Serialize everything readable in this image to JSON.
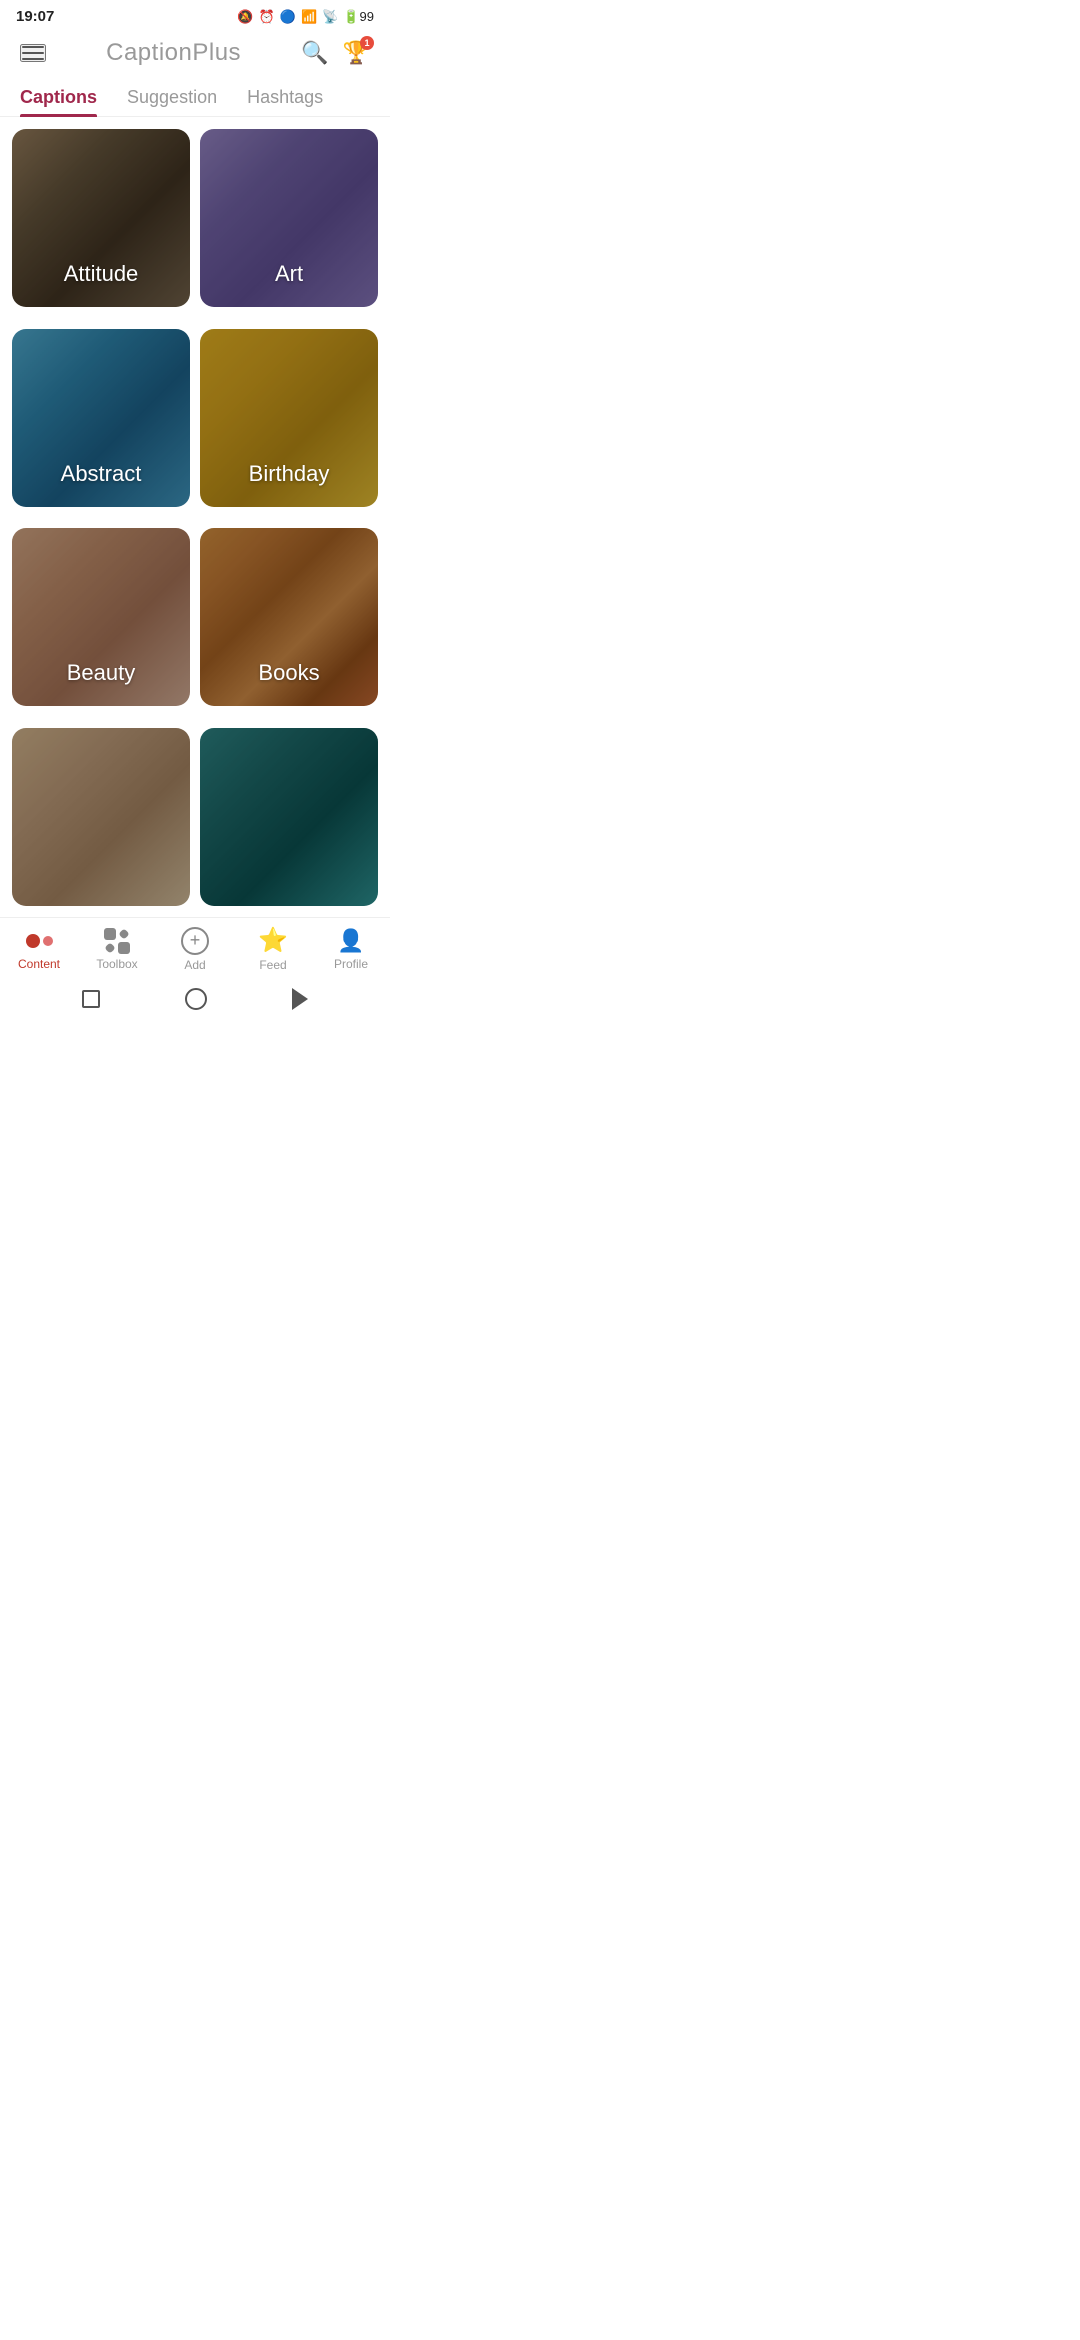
{
  "statusBar": {
    "time": "19:07",
    "batteryLevel": "99"
  },
  "appBar": {
    "title": "CaptionPlus",
    "menuLabel": "menu",
    "searchLabel": "search",
    "trophyLabel": "trophy",
    "trophyBadge": "1"
  },
  "tabs": [
    {
      "id": "captions",
      "label": "Captions",
      "active": true
    },
    {
      "id": "suggestion",
      "label": "Suggestion",
      "active": false
    },
    {
      "id": "hashtags",
      "label": "Hashtags",
      "active": false
    }
  ],
  "grid": {
    "items": [
      {
        "id": "attitude",
        "label": "Attitude",
        "bgClass": "bg-attitude"
      },
      {
        "id": "art",
        "label": "Art",
        "bgClass": "bg-art"
      },
      {
        "id": "abstract",
        "label": "Abstract",
        "bgClass": "bg-abstract"
      },
      {
        "id": "birthday",
        "label": "Birthday",
        "bgClass": "bg-birthday"
      },
      {
        "id": "beauty",
        "label": "Beauty",
        "bgClass": "bg-beauty"
      },
      {
        "id": "books",
        "label": "Books",
        "bgClass": "bg-books"
      },
      {
        "id": "boy",
        "label": "",
        "bgClass": "bg-boy"
      },
      {
        "id": "nature",
        "label": "",
        "bgClass": "bg-nature"
      }
    ]
  },
  "bottomNav": {
    "items": [
      {
        "id": "content",
        "label": "Content",
        "active": true
      },
      {
        "id": "toolbox",
        "label": "Toolbox",
        "active": false
      },
      {
        "id": "add",
        "label": "Add",
        "active": false
      },
      {
        "id": "feed",
        "label": "Feed",
        "active": false
      },
      {
        "id": "profile",
        "label": "Profile",
        "active": false
      }
    ]
  }
}
